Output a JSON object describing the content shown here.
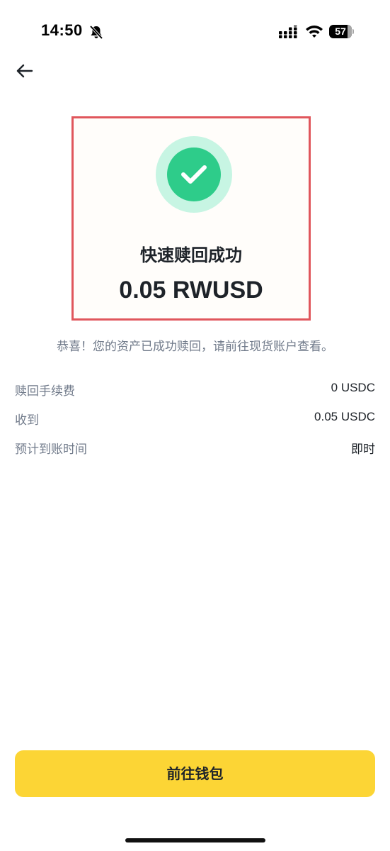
{
  "status_bar": {
    "time": "14:50",
    "battery": "57",
    "icons": [
      "bell-muted-icon",
      "signal-icon",
      "wifi-icon",
      "battery-icon"
    ]
  },
  "nav": {
    "back_icon": "arrow-left-icon"
  },
  "result": {
    "icon": "check-circle-icon",
    "title": "快速赎回成功",
    "amount": "0.05 RWUSD",
    "message": "恭喜！您的资产已成功赎回，请前往现货账户查看。"
  },
  "details": [
    {
      "label": "赎回手续费",
      "value": "0 USDC"
    },
    {
      "label": "收到",
      "value": "0.05 USDC"
    },
    {
      "label": "预计到账时间",
      "value": "即时"
    }
  ],
  "actions": {
    "wallet_label": "前往钱包"
  },
  "colors": {
    "accent_yellow": "#fcd535",
    "success_green": "#2ecc8a",
    "success_ring": "#c7f5e3",
    "highlight_border": "#e0565c",
    "secondary_text": "#707a8a"
  }
}
